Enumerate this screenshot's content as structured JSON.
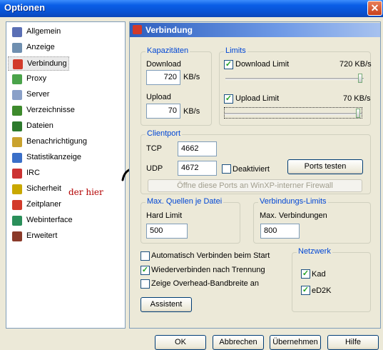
{
  "window": {
    "title": "Optionen",
    "close_glyph": "✕"
  },
  "sidebar": {
    "items": [
      {
        "label": "Allgemein",
        "icon": "gear-icon",
        "color": "#5a6fb5"
      },
      {
        "label": "Anzeige",
        "icon": "display-icon",
        "color": "#6f8fb0"
      },
      {
        "label": "Verbindung",
        "icon": "plug-icon",
        "color": "#d23a2a"
      },
      {
        "label": "Proxy",
        "icon": "proxy-icon",
        "color": "#4aa34a"
      },
      {
        "label": "Server",
        "icon": "server-icon",
        "color": "#8aa0c8"
      },
      {
        "label": "Verzeichnisse",
        "icon": "folder-icon",
        "color": "#3d8a2c"
      },
      {
        "label": "Dateien",
        "icon": "files-icon",
        "color": "#2d7a2d"
      },
      {
        "label": "Benachrichtigung",
        "icon": "notify-icon",
        "color": "#c9a22e"
      },
      {
        "label": "Statistikanzeige",
        "icon": "stats-icon",
        "color": "#3a6fc8"
      },
      {
        "label": "IRC",
        "icon": "irc-icon",
        "color": "#c33"
      },
      {
        "label": "Sicherheit",
        "icon": "security-icon",
        "color": "#c9a800"
      },
      {
        "label": "Zeitplaner",
        "icon": "calendar-icon",
        "color": "#d23a2a"
      },
      {
        "label": "Webinterface",
        "icon": "globe-icon",
        "color": "#2a8f5a"
      },
      {
        "label": "Erweitert",
        "icon": "advanced-icon",
        "color": "#8a3a2a"
      }
    ],
    "selected_index": 2
  },
  "annotation": "der hier",
  "panel": {
    "title": "Verbindung"
  },
  "capacities": {
    "title": "Kapazitäten",
    "download_label": "Download",
    "download_value": "720",
    "download_unit": "KB/s",
    "upload_label": "Upload",
    "upload_value": "70",
    "upload_unit": "KB/s"
  },
  "limits": {
    "title": "Limits",
    "download_limit_label": "Download Limit",
    "download_limit_value": "720 KB/s",
    "download_checked": true,
    "download_slider": 1.0,
    "upload_limit_label": "Upload Limit",
    "upload_limit_value": "70 KB/s",
    "upload_checked": true,
    "upload_slider": 1.0
  },
  "clientport": {
    "title": "Clientport",
    "tcp_label": "TCP",
    "tcp_value": "4662",
    "udp_label": "UDP",
    "udp_value": "4672",
    "deactivated_label": "Deaktiviert",
    "deactivated_checked": false,
    "test_button": "Ports testen",
    "firewall_button": "Öffne diese Ports an WinXP-interner Firewall"
  },
  "max_sources": {
    "title": "Max. Quellen je Datei",
    "hard_limit_label": "Hard Limit",
    "hard_limit_value": "500"
  },
  "conn_limits": {
    "title": "Verbindungs-Limits",
    "max_conn_label": "Max. Verbindungen",
    "max_conn_value": "800"
  },
  "options": [
    {
      "label": "Automatisch Verbinden beim Start",
      "checked": false
    },
    {
      "label": "Wiederverbinden nach Trennung",
      "checked": true
    },
    {
      "label": "Zeige Overhead-Bandbreite an",
      "checked": false
    }
  ],
  "assistant_button": "Assistent",
  "network": {
    "title": "Netzwerk",
    "kad_label": "Kad",
    "kad_checked": true,
    "ed2k_label": "eD2K",
    "ed2k_checked": true
  },
  "footer": {
    "ok": "OK",
    "cancel": "Abbrechen",
    "apply": "Übernehmen",
    "help": "Hilfe"
  }
}
